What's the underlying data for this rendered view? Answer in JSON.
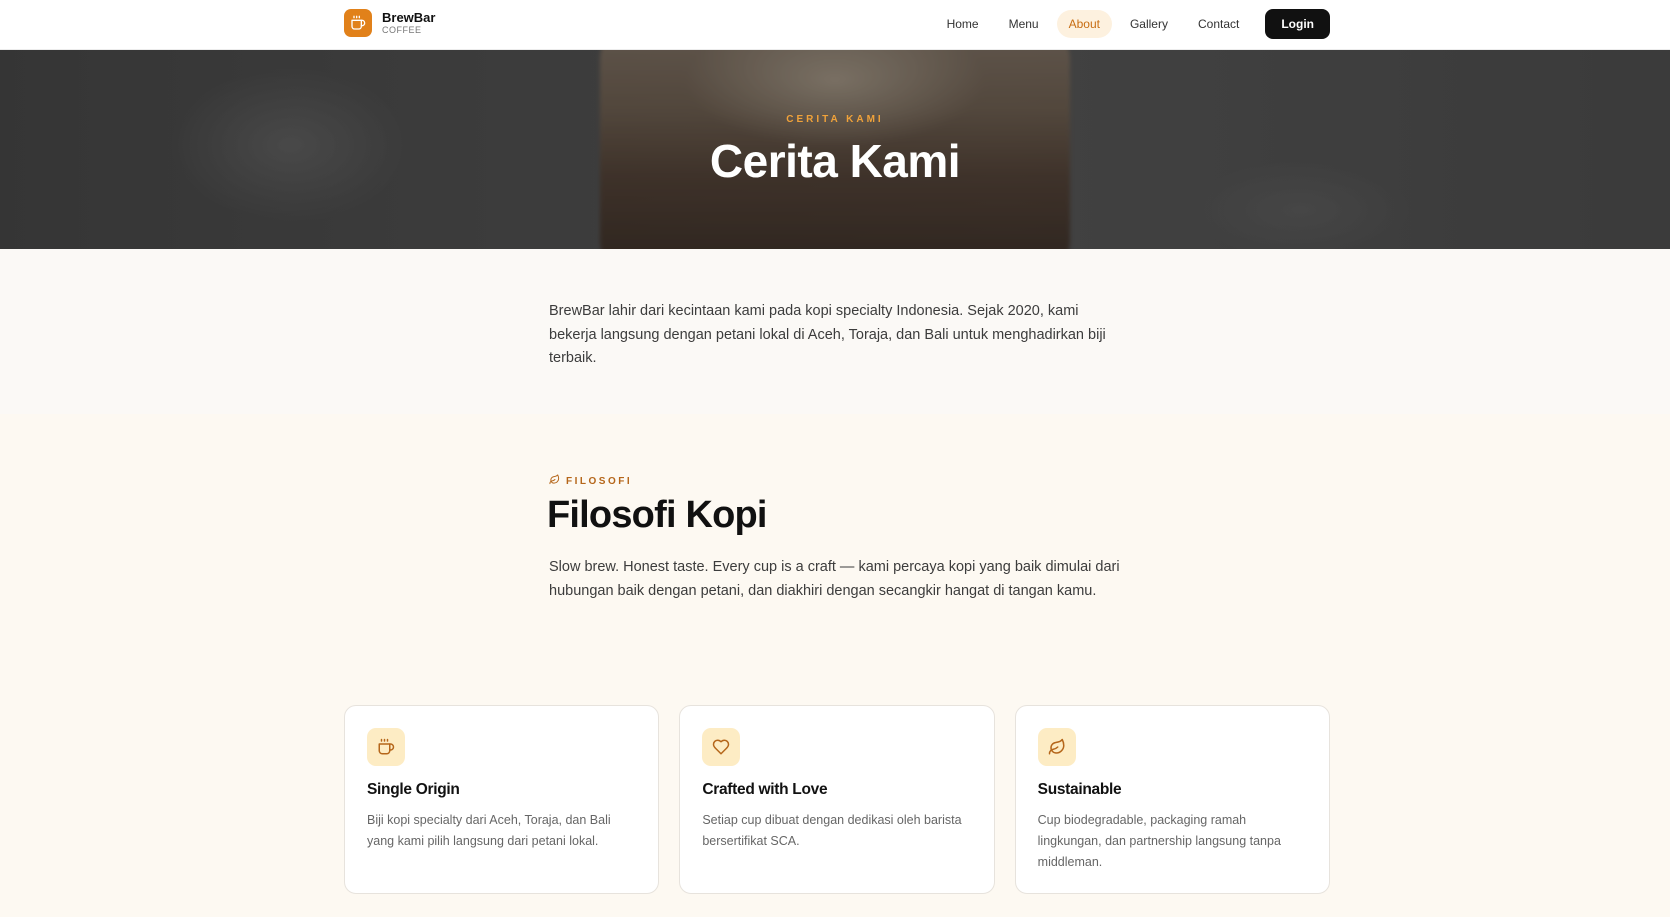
{
  "navbar": {
    "brand_name": "BrewBar",
    "brand_sub": "COFFEE",
    "brand_icon": "coffee-cup-icon",
    "links": [
      {
        "label": "Home",
        "active": false
      },
      {
        "label": "Menu",
        "active": false
      },
      {
        "label": "About",
        "active": true
      },
      {
        "label": "Gallery",
        "active": false
      },
      {
        "label": "Contact",
        "active": false
      }
    ],
    "login_label": "Login"
  },
  "hero": {
    "eyebrow": "CERITA KAMI",
    "title": "Cerita Kami"
  },
  "intro": {
    "text": "BrewBar lahir dari kecintaan kami pada kopi specialty Indonesia. Sejak 2020, kami bekerja langsung dengan petani lokal di Aceh, Toraja, dan Bali untuk menghadirkan biji terbaik."
  },
  "philosophy": {
    "eyebrow": "FILOSOFI",
    "eyebrow_icon": "leaf-icon",
    "title": "Filosofi Kopi",
    "text": "Slow brew. Honest taste. Every cup is a craft — kami percaya kopi yang baik dimulai dari hubungan baik dengan petani, dan diakhiri dengan secangkir hangat di tangan kamu."
  },
  "cards": [
    {
      "icon": "coffee-cup-icon",
      "title": "Single Origin",
      "desc": "Biji kopi specialty dari Aceh, Toraja, dan Bali yang kami pilih langsung dari petani lokal."
    },
    {
      "icon": "heart-icon",
      "title": "Crafted with Love",
      "desc": "Setiap cup dibuat dengan dedikasi oleh barista bersertifikat SCA."
    },
    {
      "icon": "leaf-icon",
      "title": "Sustainable",
      "desc": "Cup biodegradable, packaging ramah lingkungan, dan partnership langsung tanpa middleman."
    }
  ],
  "colors": {
    "accent": "#e1811a",
    "accent_text": "#c86d12",
    "icon_bg": "#fdecc4",
    "login_bg": "#111111"
  }
}
